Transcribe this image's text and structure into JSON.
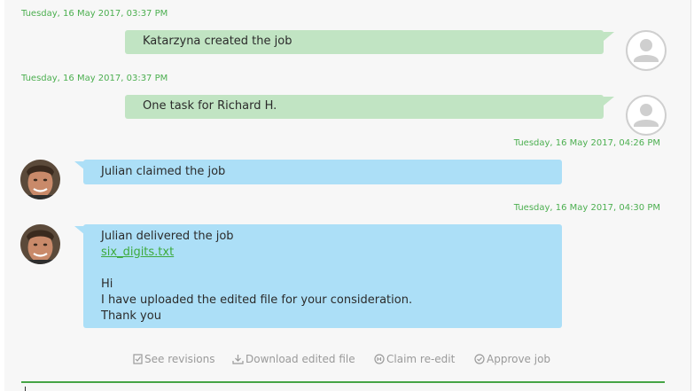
{
  "messages": [
    {
      "timestamp": "Tuesday, 16 May 2017, 03:37 PM",
      "text": "Katarzyna created the job",
      "avatar": "default-user-icon",
      "side": "right"
    },
    {
      "timestamp": "Tuesday, 16 May 2017, 03:37 PM",
      "text": "One task for Richard H.",
      "avatar": "default-user-icon",
      "side": "right"
    },
    {
      "timestamp": "Tuesday, 16 May 2017, 04:26 PM",
      "text": "Julian claimed the job",
      "avatar": "julian-photo",
      "side": "left"
    },
    {
      "timestamp": "Tuesday, 16 May 2017, 04:30 PM",
      "text": "Julian delivered the job",
      "attachment": "six_digits.txt",
      "body_lines": [
        "Hi",
        "I have uploaded the edited file for your consideration.",
        "Thank you"
      ],
      "avatar": "julian-photo",
      "side": "left"
    }
  ],
  "actions": {
    "see_revisions": "See revisions",
    "download_edited_file": "Download edited file",
    "claim_reedit": "Claim re-edit",
    "approve_job": "Approve job"
  },
  "colors": {
    "timestamp_green": "#4caf50",
    "system_bubble": "#c1e4c3",
    "user_bubble": "#acdff7",
    "link_green": "#3daa3d",
    "divider_green": "#46a546"
  }
}
